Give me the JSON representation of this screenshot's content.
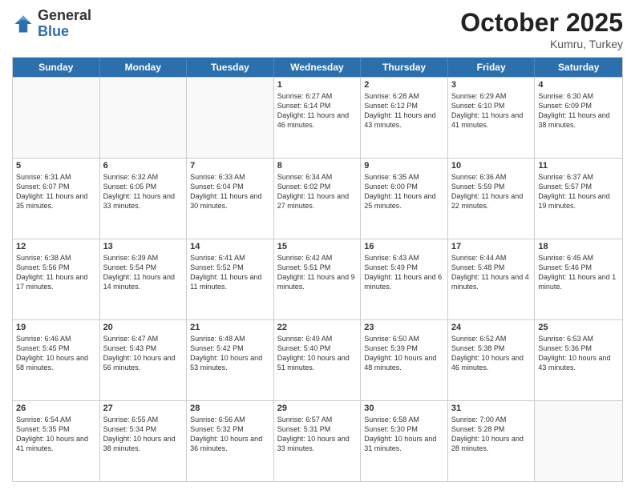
{
  "header": {
    "logo_general": "General",
    "logo_blue": "Blue",
    "month": "October 2025",
    "location": "Kumru, Turkey"
  },
  "weekdays": [
    "Sunday",
    "Monday",
    "Tuesday",
    "Wednesday",
    "Thursday",
    "Friday",
    "Saturday"
  ],
  "rows": [
    [
      {
        "day": "",
        "text": "",
        "empty": true
      },
      {
        "day": "",
        "text": "",
        "empty": true
      },
      {
        "day": "",
        "text": "",
        "empty": true
      },
      {
        "day": "1",
        "text": "Sunrise: 6:27 AM\nSunset: 6:14 PM\nDaylight: 11 hours and 46 minutes."
      },
      {
        "day": "2",
        "text": "Sunrise: 6:28 AM\nSunset: 6:12 PM\nDaylight: 11 hours and 43 minutes."
      },
      {
        "day": "3",
        "text": "Sunrise: 6:29 AM\nSunset: 6:10 PM\nDaylight: 11 hours and 41 minutes."
      },
      {
        "day": "4",
        "text": "Sunrise: 6:30 AM\nSunset: 6:09 PM\nDaylight: 11 hours and 38 minutes."
      }
    ],
    [
      {
        "day": "5",
        "text": "Sunrise: 6:31 AM\nSunset: 6:07 PM\nDaylight: 11 hours and 35 minutes."
      },
      {
        "day": "6",
        "text": "Sunrise: 6:32 AM\nSunset: 6:05 PM\nDaylight: 11 hours and 33 minutes."
      },
      {
        "day": "7",
        "text": "Sunrise: 6:33 AM\nSunset: 6:04 PM\nDaylight: 11 hours and 30 minutes."
      },
      {
        "day": "8",
        "text": "Sunrise: 6:34 AM\nSunset: 6:02 PM\nDaylight: 11 hours and 27 minutes."
      },
      {
        "day": "9",
        "text": "Sunrise: 6:35 AM\nSunset: 6:00 PM\nDaylight: 11 hours and 25 minutes."
      },
      {
        "day": "10",
        "text": "Sunrise: 6:36 AM\nSunset: 5:59 PM\nDaylight: 11 hours and 22 minutes."
      },
      {
        "day": "11",
        "text": "Sunrise: 6:37 AM\nSunset: 5:57 PM\nDaylight: 11 hours and 19 minutes."
      }
    ],
    [
      {
        "day": "12",
        "text": "Sunrise: 6:38 AM\nSunset: 5:56 PM\nDaylight: 11 hours and 17 minutes."
      },
      {
        "day": "13",
        "text": "Sunrise: 6:39 AM\nSunset: 5:54 PM\nDaylight: 11 hours and 14 minutes."
      },
      {
        "day": "14",
        "text": "Sunrise: 6:41 AM\nSunset: 5:52 PM\nDaylight: 11 hours and 11 minutes."
      },
      {
        "day": "15",
        "text": "Sunrise: 6:42 AM\nSunset: 5:51 PM\nDaylight: 11 hours and 9 minutes."
      },
      {
        "day": "16",
        "text": "Sunrise: 6:43 AM\nSunset: 5:49 PM\nDaylight: 11 hours and 6 minutes."
      },
      {
        "day": "17",
        "text": "Sunrise: 6:44 AM\nSunset: 5:48 PM\nDaylight: 11 hours and 4 minutes."
      },
      {
        "day": "18",
        "text": "Sunrise: 6:45 AM\nSunset: 5:46 PM\nDaylight: 11 hours and 1 minute."
      }
    ],
    [
      {
        "day": "19",
        "text": "Sunrise: 6:46 AM\nSunset: 5:45 PM\nDaylight: 10 hours and 58 minutes."
      },
      {
        "day": "20",
        "text": "Sunrise: 6:47 AM\nSunset: 5:43 PM\nDaylight: 10 hours and 56 minutes."
      },
      {
        "day": "21",
        "text": "Sunrise: 6:48 AM\nSunset: 5:42 PM\nDaylight: 10 hours and 53 minutes."
      },
      {
        "day": "22",
        "text": "Sunrise: 6:49 AM\nSunset: 5:40 PM\nDaylight: 10 hours and 51 minutes."
      },
      {
        "day": "23",
        "text": "Sunrise: 6:50 AM\nSunset: 5:39 PM\nDaylight: 10 hours and 48 minutes."
      },
      {
        "day": "24",
        "text": "Sunrise: 6:52 AM\nSunset: 5:38 PM\nDaylight: 10 hours and 46 minutes."
      },
      {
        "day": "25",
        "text": "Sunrise: 6:53 AM\nSunset: 5:36 PM\nDaylight: 10 hours and 43 minutes."
      }
    ],
    [
      {
        "day": "26",
        "text": "Sunrise: 6:54 AM\nSunset: 5:35 PM\nDaylight: 10 hours and 41 minutes."
      },
      {
        "day": "27",
        "text": "Sunrise: 6:55 AM\nSunset: 5:34 PM\nDaylight: 10 hours and 38 minutes."
      },
      {
        "day": "28",
        "text": "Sunrise: 6:56 AM\nSunset: 5:32 PM\nDaylight: 10 hours and 36 minutes."
      },
      {
        "day": "29",
        "text": "Sunrise: 6:57 AM\nSunset: 5:31 PM\nDaylight: 10 hours and 33 minutes."
      },
      {
        "day": "30",
        "text": "Sunrise: 6:58 AM\nSunset: 5:30 PM\nDaylight: 10 hours and 31 minutes."
      },
      {
        "day": "31",
        "text": "Sunrise: 7:00 AM\nSunset: 5:28 PM\nDaylight: 10 hours and 28 minutes."
      },
      {
        "day": "",
        "text": "",
        "empty": true
      }
    ]
  ]
}
